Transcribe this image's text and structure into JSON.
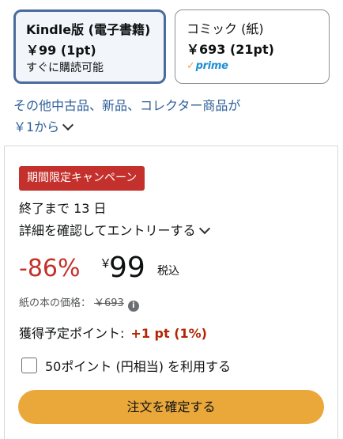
{
  "formats": [
    {
      "name": "Kindle版 (電子書籍)",
      "price": "￥99 (1pt)",
      "note": "すぐに購読可能",
      "selected": true
    },
    {
      "name": "コミック (紙)",
      "price": "￥693 (21pt)",
      "badge": "prime",
      "selected": false
    }
  ],
  "other_offers": {
    "line1": "その他中古品、新品、コレクター商品が",
    "line2": "￥1から"
  },
  "campaign": {
    "badge": "期間限定キャンペーン",
    "ends": "終了まで 13 日",
    "details_link": "詳細を確認してエントリーする"
  },
  "price": {
    "discount": "-86%",
    "currency": "￥",
    "amount": "99",
    "tax_label": "税込",
    "paper_label": "紙の本の価格：",
    "paper_price": "￥693"
  },
  "points": {
    "label": "獲得予定ポイント:",
    "value": "+1 pt (1%)"
  },
  "use_points": {
    "label": "50ポイント (円相当) を利用する",
    "checked": false
  },
  "order_button": {
    "label": "注文を確定する"
  },
  "colors": {
    "accent_red": "#c4302b",
    "button": "#eaa83b",
    "link": "#2f5f9a",
    "selected_border": "#4a6b9c"
  }
}
